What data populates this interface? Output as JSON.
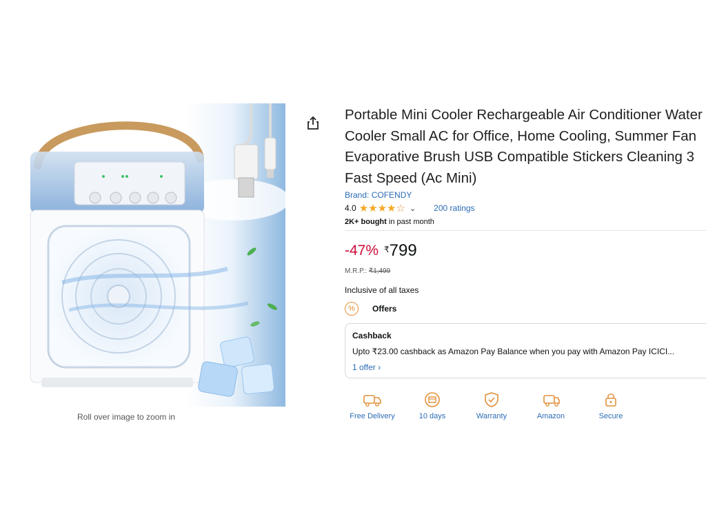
{
  "product": {
    "title": "Portable Mini Cooler Rechargeable Air Conditioner Water Cooler Small AC for Office, Home Cooling, Summer Fan Evaporative Brush USB Compatible Stickers Cleaning 3 Fast Speed (Ac Mini)",
    "brand": "Brand: COFENDY",
    "rating_value": "4.0",
    "rating": 4.0,
    "ratings_count": "200 ratings",
    "bought_bold": "2K+ bought",
    "bought_rest": " in past month",
    "zoom_hint": "Roll over image to zoom in"
  },
  "price": {
    "discount": "-47%",
    "currency": "₹",
    "amount": "799",
    "mrp_label": "M.R.P.: ",
    "mrp_value": "₹1,499",
    "taxes": "Inclusive of all taxes"
  },
  "offers": {
    "icon_glyph": "%",
    "label": "Offers",
    "cashback_title": "Cashback",
    "cashback_text": "Upto ₹23.00 cashback as Amazon Pay Balance when you pay with Amazon Pay ICICI...",
    "cashback_link": "1 offer ›"
  },
  "features": [
    {
      "label": "Free Delivery",
      "icon": "delivery-truck-icon"
    },
    {
      "label": "10 days",
      "icon": "return-box-icon"
    },
    {
      "label": "Warranty",
      "icon": "warranty-shield-icon"
    },
    {
      "label": "Amazon",
      "icon": "amazon-delivered-truck-icon"
    },
    {
      "label": "Secure",
      "icon": "secure-lock-icon"
    }
  ],
  "colors": {
    "link": "#2a6bb5",
    "discount": "#cc0c39",
    "star": "#f5a623",
    "feature_icon": "#e3903a"
  }
}
